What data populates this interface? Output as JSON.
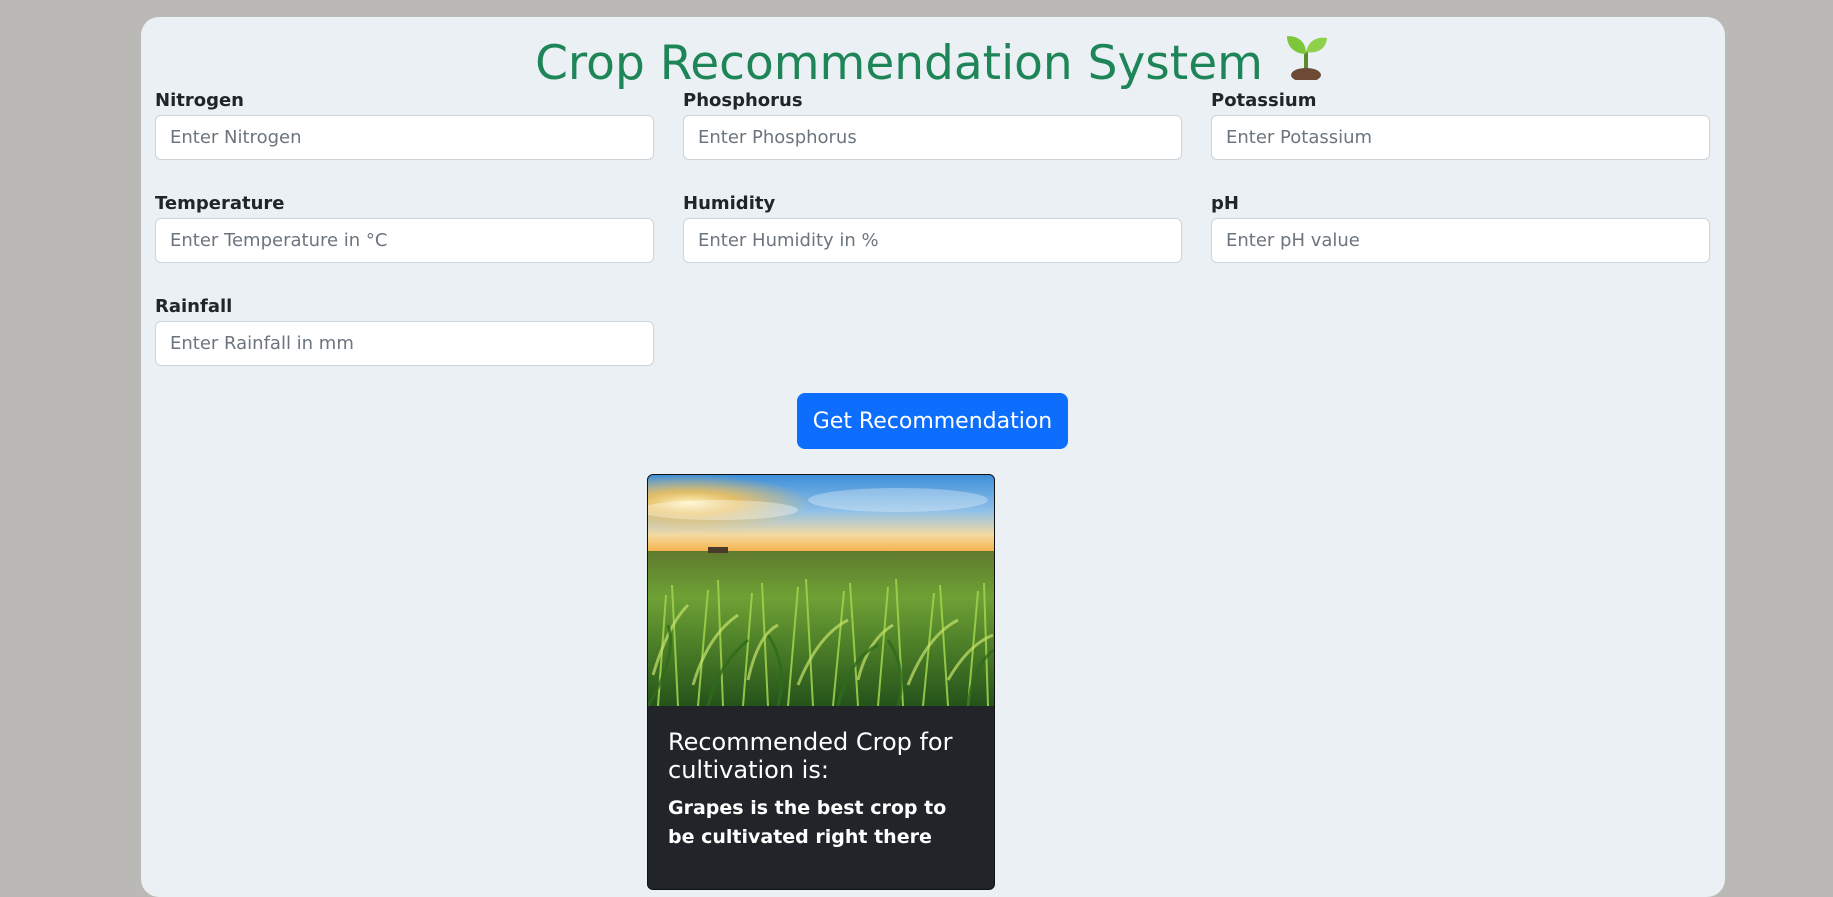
{
  "header": {
    "title": "Crop Recommendation System",
    "icon": "seedling-icon"
  },
  "form": {
    "fields": [
      {
        "label": "Nitrogen",
        "placeholder": "Enter Nitrogen",
        "value": ""
      },
      {
        "label": "Phosphorus",
        "placeholder": "Enter Phosphorus",
        "value": ""
      },
      {
        "label": "Potassium",
        "placeholder": "Enter Potassium",
        "value": ""
      },
      {
        "label": "Temperature",
        "placeholder": "Enter Temperature in °C",
        "value": ""
      },
      {
        "label": "Humidity",
        "placeholder": "Enter Humidity in %",
        "value": ""
      },
      {
        "label": "pH",
        "placeholder": "Enter pH value",
        "value": ""
      },
      {
        "label": "Rainfall",
        "placeholder": "Enter Rainfall in mm",
        "value": ""
      }
    ],
    "submit_label": "Get Recommendation"
  },
  "result": {
    "image": "crop-field-image",
    "title": "Recommended Crop for cultivation is:",
    "text": "Grapes is the best crop to be cultivated right there"
  },
  "colors": {
    "background": "#bab9b6",
    "panel": "#ebf0f4",
    "title": "#1d8557",
    "button": "#0d6efd",
    "card": "#212529"
  }
}
